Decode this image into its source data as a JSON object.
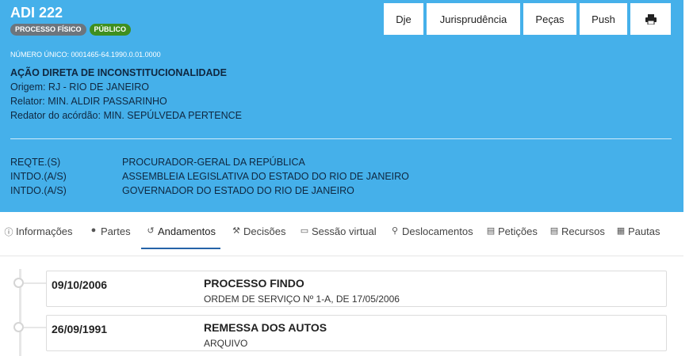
{
  "header": {
    "title": "ADI 222",
    "badges": [
      "PROCESSO FÍSICO",
      "PÚBLICO"
    ],
    "buttons": [
      "Dje",
      "Jurisprudência",
      "Peças",
      "Push"
    ],
    "print_icon": "print-icon",
    "numero_unico": "NÚMERO ÚNICO: 0001465-64.1990.0.01.0000",
    "classe": "AÇÃO DIRETA DE INCONSTITUCIONALIDADE",
    "origem": "Origem: RJ - RIO DE JANEIRO",
    "relator": "Relator: MIN. ALDIR PASSARINHO",
    "redator": "Redator do acórdão: MIN. SEPÚLVEDA PERTENCE",
    "partes": [
      {
        "tipo": "REQTE.(S)",
        "nome": "PROCURADOR-GERAL DA REPÚBLICA"
      },
      {
        "tipo": "INTDO.(A/S)",
        "nome": "ASSEMBLEIA LEGISLATIVA DO ESTADO DO RIO DE JANEIRO"
      },
      {
        "tipo": "INTDO.(A/S)",
        "nome": "GOVERNADOR DO ESTADO DO RIO DE JANEIRO"
      }
    ]
  },
  "tabs": [
    {
      "label": "Informações",
      "icon": "info-circle-icon"
    },
    {
      "label": "Partes",
      "icon": "users-icon"
    },
    {
      "label": "Andamentos",
      "icon": "history-icon"
    },
    {
      "label": "Decisões",
      "icon": "gavel-icon"
    },
    {
      "label": "Sessão virtual",
      "icon": "monitor-icon"
    },
    {
      "label": "Deslocamentos",
      "icon": "map-marker-icon"
    },
    {
      "label": "Petições",
      "icon": "file-pdf-icon"
    },
    {
      "label": "Recursos",
      "icon": "file-text-icon"
    },
    {
      "label": "Pautas",
      "icon": "calendar-icon"
    }
  ],
  "active_tab": "Andamentos",
  "andamentos": [
    {
      "data": "09/10/2006",
      "titulo": "PROCESSO FINDO",
      "descricao": "ORDEM DE SERVIÇO Nº 1-A, DE 17/05/2006"
    },
    {
      "data": "26/09/1991",
      "titulo": "REMESSA DOS AUTOS",
      "descricao": "ARQUIVO"
    }
  ],
  "colors": {
    "header_bg": "#45b0ea",
    "badge_fisico": "#6c757d",
    "badge_publico": "#3f8f1f",
    "active_tab_underline": "#2563a8"
  }
}
